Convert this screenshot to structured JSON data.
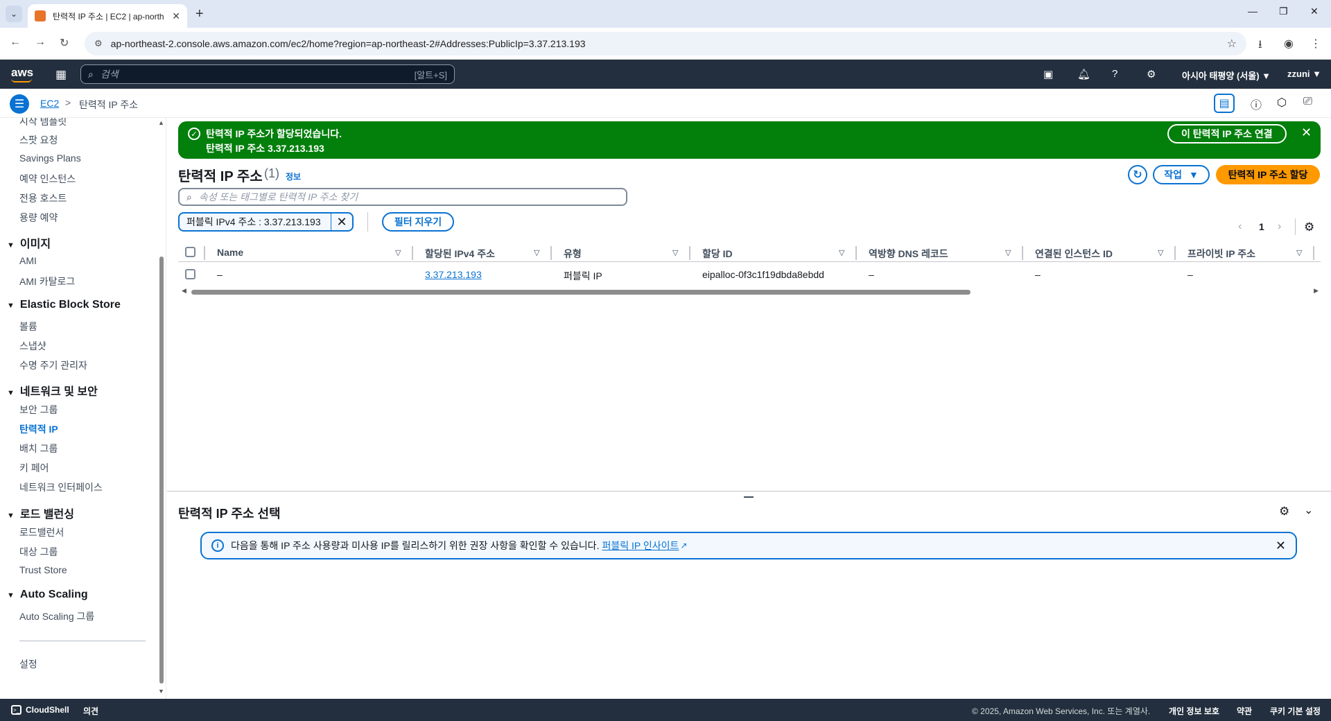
{
  "browser": {
    "tab_title": "탄력적 IP 주소 | EC2 | ap-north",
    "url": "ap-northeast-2.console.aws.amazon.com/ec2/home?region=ap-northeast-2#Addresses:PublicIp=3.37.213.193"
  },
  "aws_nav": {
    "logo": "aws",
    "search_placeholder": "검색",
    "search_shortcut": "[알트+S]",
    "region": "아시아 태평양 (서울) ▼",
    "user": "zzuni ▼"
  },
  "breadcrumb": {
    "root": "EC2",
    "separator": ">",
    "current": "탄력적 IP 주소"
  },
  "sidebar": {
    "items_top": [
      "시작 템플릿",
      "스팟 요청",
      "Savings Plans",
      "예약 인스턴스",
      "전용 호스트",
      "용량 예약"
    ],
    "sections": [
      {
        "title": "이미지",
        "items": [
          "AMI",
          "AMI 카탈로그"
        ]
      },
      {
        "title": "Elastic Block Store",
        "items": [
          "볼륨",
          "스냅샷",
          "수명 주기 관리자"
        ]
      },
      {
        "title": "네트워크 및 보안",
        "items": [
          "보안 그룹",
          "탄력적 IP",
          "배치 그룹",
          "키 페어",
          "네트워크 인터페이스"
        ]
      },
      {
        "title": "로드 밸런싱",
        "items": [
          "로드밸런서",
          "대상 그룹",
          "Trust Store"
        ]
      },
      {
        "title": "Auto Scaling",
        "items": [
          "Auto Scaling 그룹"
        ]
      }
    ],
    "settings": "설정",
    "active_item": "탄력적 IP"
  },
  "flash": {
    "line1": "탄력적 IP 주소가 할당되었습니다.",
    "line2": "탄력적 IP 주소 3.37.213.193",
    "button": "이 탄력적 IP 주소 연결",
    "color": "#037f0c"
  },
  "header": {
    "title": "탄력적 IP 주소",
    "count": "(1)",
    "info": "정보",
    "actions_label": "작업",
    "primary_label": "탄력적 IP 주소 할당"
  },
  "search": {
    "placeholder": "속성 또는 태그별로 탄력적 IP 주소 찾기"
  },
  "filter": {
    "token": "퍼블릭 IPv4 주소 : 3.37.213.193",
    "clear_label": "필터 지우기"
  },
  "pagination": {
    "current_page": "1"
  },
  "table": {
    "columns": [
      "Name",
      "할당된 IPv4 주소",
      "유형",
      "할당 ID",
      "역방향 DNS 레코드",
      "연결된 인스턴스 ID",
      "프라이빗 IP 주소"
    ],
    "rows": [
      [
        "–",
        "3.37.213.193",
        "퍼블릭 IP",
        "eipalloc-0f3c1f19dbda8ebdd",
        "–",
        "–",
        "–"
      ]
    ]
  },
  "split_panel": {
    "title": "탄력적 IP 주소 선택",
    "alert_text": "다음을 통해 IP 주소 사용량과 미사용 IP를 릴리스하기 위한 권장 사항을 확인할 수 있습니다.",
    "alert_link": "퍼블릭 IP 인사이트"
  },
  "footer": {
    "cloudshell": "CloudShell",
    "feedback": "의견",
    "copyright": "© 2025, Amazon Web Services, Inc. 또는 계열사.",
    "privacy": "개인 정보 보호",
    "terms": "약관",
    "cookies": "쿠키 기본 설정"
  },
  "colors": {
    "accent": "#0972d3",
    "primary_button": "#ff9900",
    "nav_bg": "#232f3e"
  }
}
